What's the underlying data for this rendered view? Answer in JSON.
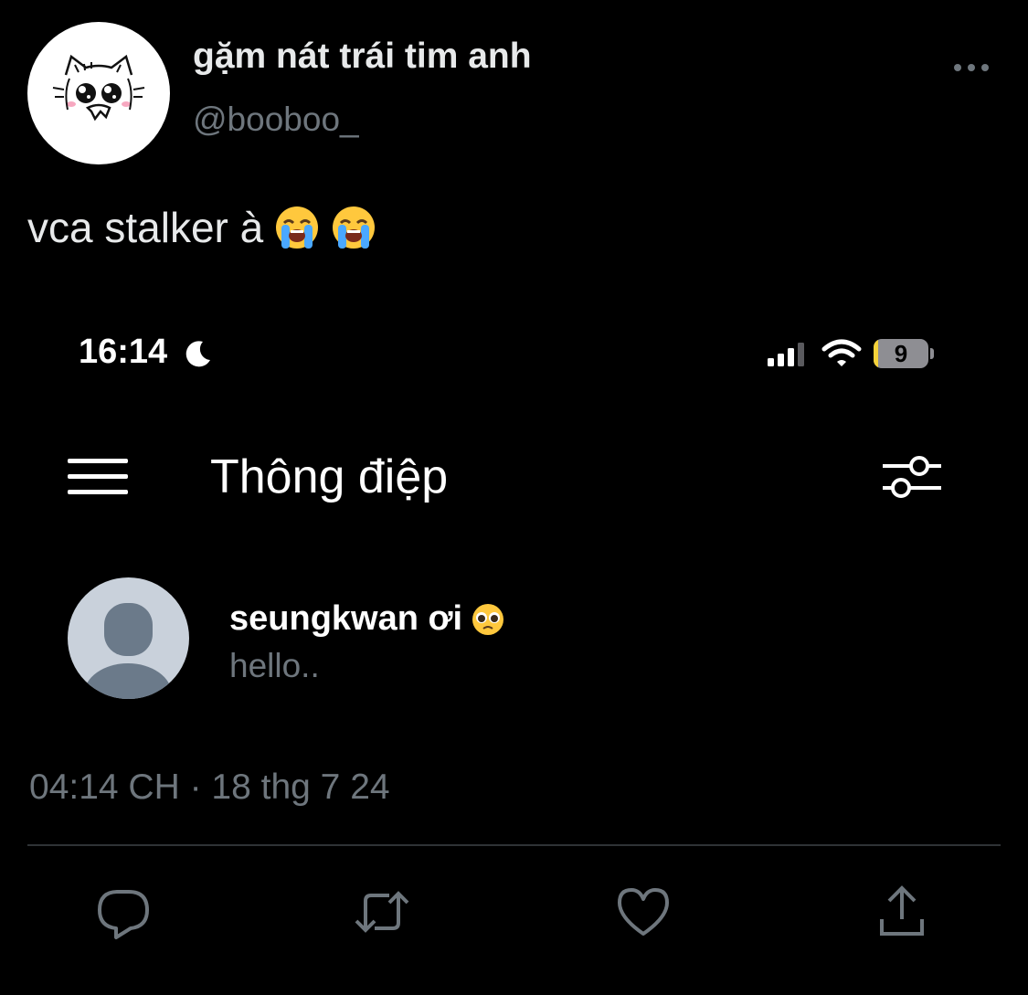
{
  "tweet": {
    "display_name": "gặm nát trái tim anh",
    "handle": "@booboo_",
    "text": "vca stalker à",
    "text_emojis": [
      "loudly-crying-face",
      "loudly-crying-face"
    ],
    "timestamp": "04:14 CH · 18 thg 7 24"
  },
  "embedded_screenshot": {
    "status_bar": {
      "time": "16:14",
      "battery_level": "9",
      "battery_fraction": 0.09
    },
    "header": {
      "title": "Thông điệp"
    },
    "conversation": {
      "name": "seungkwan ơi",
      "name_emoji": "pleading-face",
      "preview": "hello.."
    }
  },
  "actions": [
    "reply-icon",
    "retweet-icon",
    "like-icon",
    "share-icon"
  ],
  "colors": {
    "background": "#000000",
    "primary_text": "#e7e9ea",
    "secondary_text": "#6e767d",
    "icon": "#6e767d",
    "divider": "#2f3336",
    "battery_fill": "#f6d33a"
  }
}
